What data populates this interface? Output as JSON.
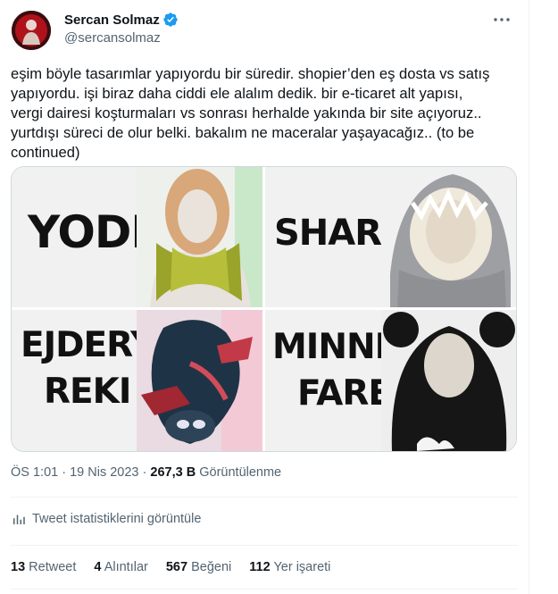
{
  "author": {
    "name": "Sercan Solmaz",
    "handle": "@sercansolmaz",
    "verified_icon": "verified-badge-icon"
  },
  "tweet": {
    "text": "eşim böyle tasarımlar yapıyordu bir süredir. shopier’den eş dosta vs satış\nyapıyordu. işi biraz daha ciddi ele alalım dedik. bir e-ticaret alt yapısı,\nvergi dairesi koşturmaları vs sonrası herhalde yakında bir site açıyoruz..\nyurtdışı süreci de olur belki. bakalım ne maceralar yaşayacağız.. (to be\ncontinued)"
  },
  "media": {
    "products": [
      {
        "line1": "YODI",
        "line2": ""
      },
      {
        "line1": "SHARKY",
        "line2": ""
      },
      {
        "line1": "EJDERYA",
        "line2": "REKI"
      },
      {
        "line1": "MINNIEK",
        "line2": "FARE"
      }
    ]
  },
  "meta": {
    "time": "ÖS 1:01",
    "date": "19 Nis 2023",
    "separator": "·",
    "views_count": "267,3 B",
    "views_label": "Görüntülenme"
  },
  "analytics": {
    "label": "Tweet istatistiklerini görüntüle",
    "icon": "analytics-icon"
  },
  "counts": {
    "retweets": {
      "value": "13",
      "label": "Retweet"
    },
    "quotes": {
      "value": "4",
      "label": "Alıntılar"
    },
    "likes": {
      "value": "567",
      "label": "Beğeni"
    },
    "bookmarks": {
      "value": "112",
      "label": "Yer işareti"
    }
  },
  "colors": {
    "accent": "#1d9bf0",
    "muted": "#536471",
    "text": "#0f1419"
  }
}
